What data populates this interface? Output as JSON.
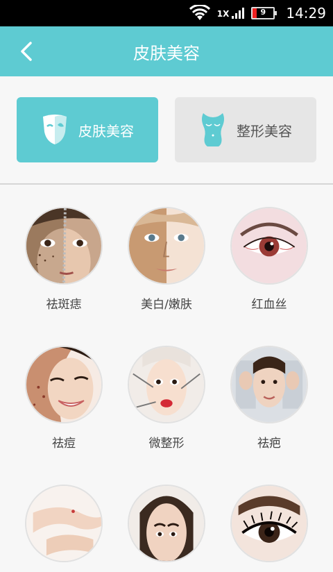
{
  "status_bar": {
    "network_label": "1X",
    "battery_level": "9",
    "time": "14:29"
  },
  "app_bar": {
    "title": "皮肤美容"
  },
  "tabs": [
    {
      "label": "皮肤美容",
      "icon": "mask-icon",
      "active": true
    },
    {
      "label": "整形美容",
      "icon": "body-silhouette-icon",
      "active": false
    }
  ],
  "items": [
    {
      "label": "祛斑痣",
      "icon": "freckle-removal-image"
    },
    {
      "label": "美白/嫩肤",
      "icon": "whitening-image"
    },
    {
      "label": "红血丝",
      "icon": "red-eye-image"
    },
    {
      "label": "祛痘",
      "icon": "acne-removal-image"
    },
    {
      "label": "微整形",
      "icon": "micro-surgery-image"
    },
    {
      "label": "祛疤",
      "icon": "scar-removal-image"
    },
    {
      "label": "",
      "icon": "arm-skin-image"
    },
    {
      "label": "",
      "icon": "face-contour-image"
    },
    {
      "label": "",
      "icon": "eyelash-image"
    }
  ],
  "colors": {
    "accent": "#5ecbd2",
    "tab_inactive": "#e6e6e6",
    "background": "#f7f7f7"
  }
}
